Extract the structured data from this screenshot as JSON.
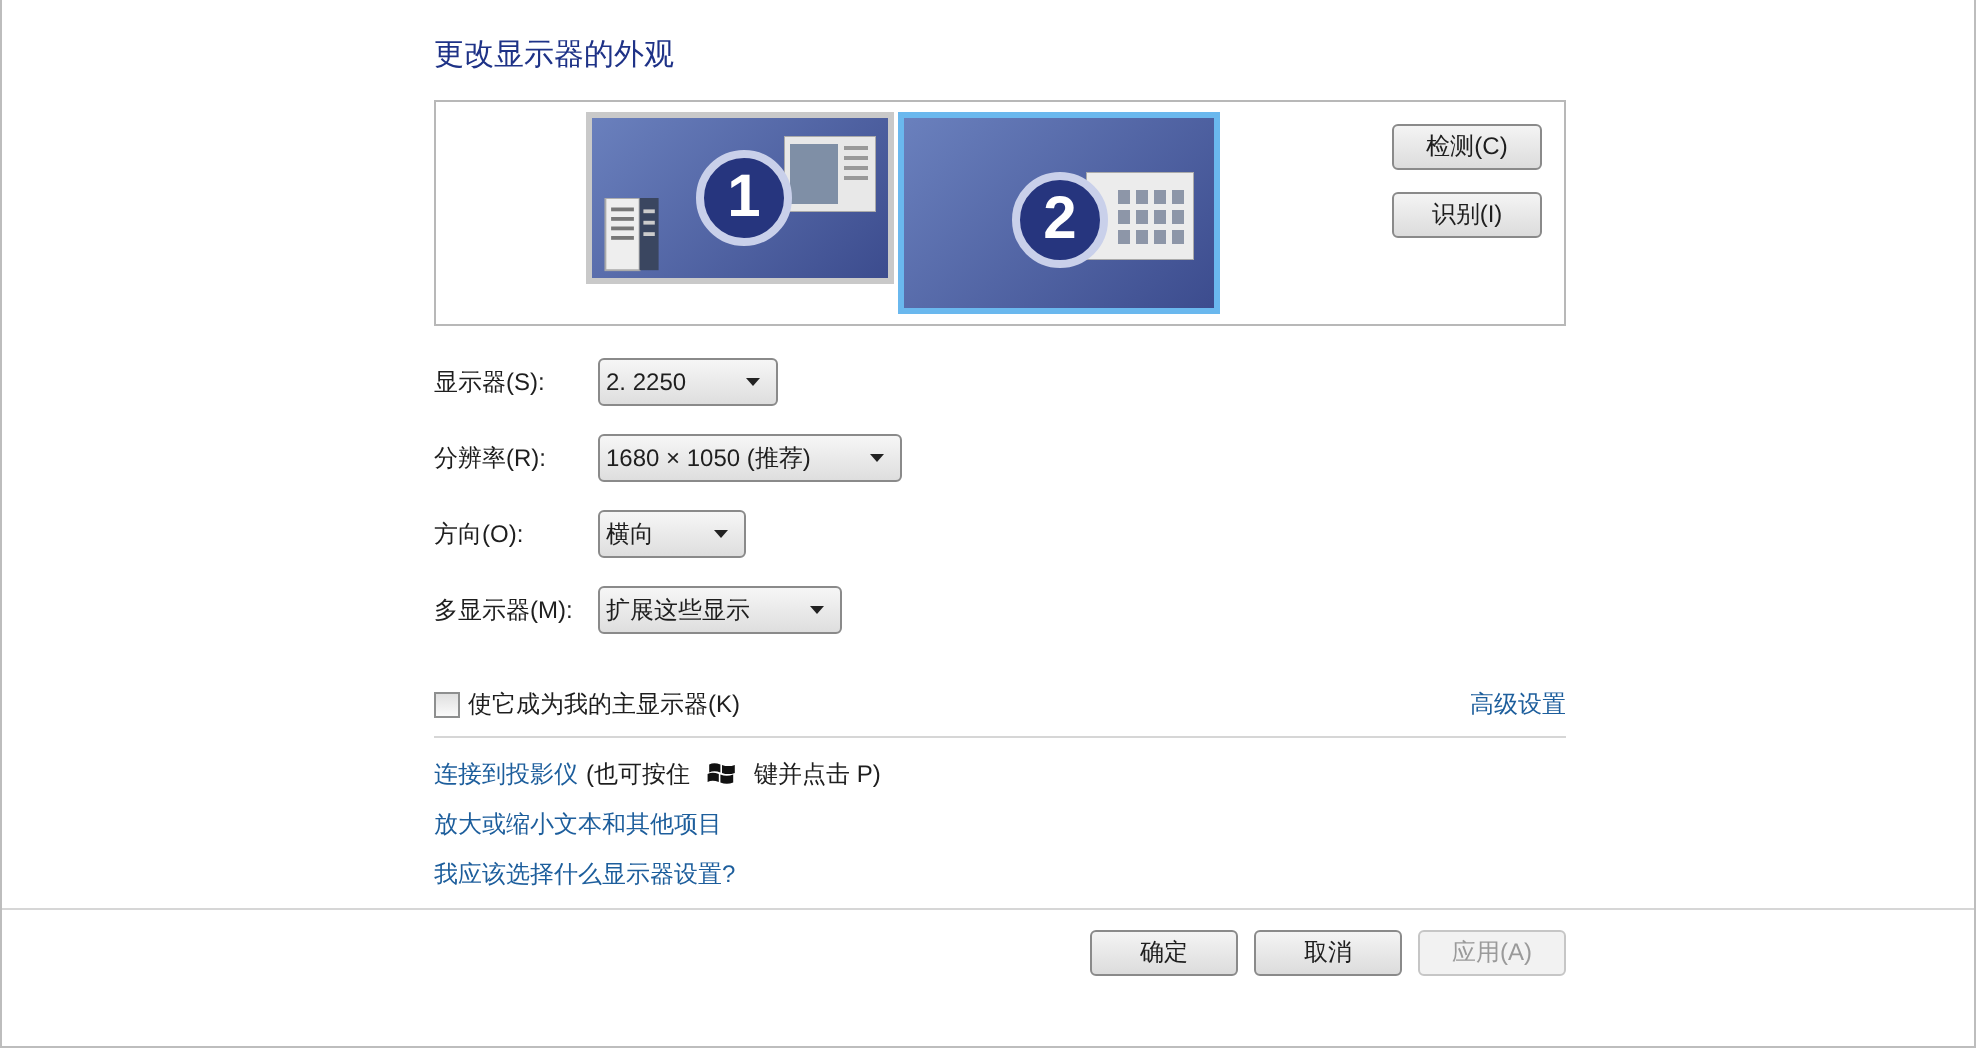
{
  "title": "更改显示器的外观",
  "monitors": [
    {
      "number": "1",
      "selected": false,
      "kind": "desktop"
    },
    {
      "number": "2",
      "selected": true,
      "kind": "grid"
    }
  ],
  "side_buttons": [
    "检测(C)",
    "识别(I)"
  ],
  "settings": [
    {
      "label": "显示器(S):",
      "value": "2. 2250"
    },
    {
      "label": "分辨率(R):",
      "value": "1680 × 1050 (推荐)"
    },
    {
      "label": "方向(O):",
      "value": "横向"
    },
    {
      "label": "多显示器(M):",
      "value": "扩展这些显示"
    }
  ],
  "primary_checkbox": {
    "label": "使它成为我的主显示器(K)",
    "checked": false
  },
  "advanced_link": "高级设置",
  "links": [
    {
      "text": "连接到投影仪",
      "hint_before": "(也可按住",
      "hint_after": "键并点击 P)"
    },
    {
      "text": "放大或缩小文本和其他项目"
    },
    {
      "text": "我应该选择什么显示器设置?"
    }
  ],
  "footer_buttons": [
    {
      "label": "确定",
      "disabled": false
    },
    {
      "label": "取消",
      "disabled": false
    },
    {
      "label": "应用(A)",
      "disabled": true
    }
  ]
}
